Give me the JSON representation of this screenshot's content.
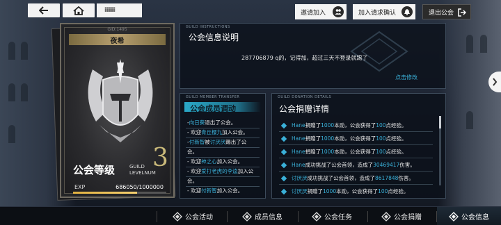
{
  "topbar": {
    "page_id": "iiiiiiiiii",
    "invite_label": "邀请加入",
    "requests_label": "加入请求确认",
    "exit_label": "退出公会",
    "back_icon": "back-arrow-icon",
    "home_icon": "home-icon"
  },
  "guild": {
    "gid": "GID:1495",
    "name": "夜希",
    "level_label": "公会等级",
    "level_sub": "GUILD LEVELNUM",
    "level": "3",
    "exp_label": "EXP",
    "exp_value": "686050/1000000",
    "exp_progress": 0.686
  },
  "info_panel": {
    "tag": "GUILD INSTRUCTIONS",
    "title": "公会信息说明",
    "text": "287706879   q的，记得加，超过三天不登录就踢了",
    "edit_label": "点击修改"
  },
  "transfer_panel": {
    "tag": "GUILD MEMBER TRANSFER",
    "title": "公会成员调动",
    "items": [
      {
        "prefix": "-",
        "name1": "向日葵",
        "text": "退出了公会。",
        "name2": "",
        "text2": ""
      },
      {
        "prefix": "- 欢迎",
        "name1": "青丘樱九",
        "text": "加入公会。",
        "name2": "",
        "text2": ""
      },
      {
        "prefix": "-",
        "name1": "付新智",
        "text": "被",
        "name2": "讨厌厌",
        "text2": "踢出了公"
      },
      {
        "prefix": "",
        "name1": "",
        "text": "会。",
        "name2": "",
        "text2": ""
      },
      {
        "prefix": "- 欢迎",
        "name1": "神之心",
        "text": "加入公会。",
        "name2": "",
        "text2": ""
      },
      {
        "prefix": "- 欢迎",
        "name1": "爱打老虎的李逵",
        "text": "加入公",
        "name2": "",
        "text2": ""
      },
      {
        "prefix": "",
        "name1": "",
        "text": "会。",
        "name2": "",
        "text2": ""
      },
      {
        "prefix": "- 欢迎",
        "name1": "付新智",
        "text": "加入公会。",
        "name2": "",
        "text2": ""
      }
    ]
  },
  "donation_panel": {
    "tag": "GUILD DONATION DETAILS",
    "title": "公会捐赠详情",
    "items": [
      {
        "name": "Hane",
        "a": "捐赠了",
        "v1": "1000",
        "b": "本勋，公会获得了",
        "v2": "100",
        "c": "点经验。"
      },
      {
        "name": "Hane",
        "a": "捐赠了",
        "v1": "1000",
        "b": "本勋，公会获得了",
        "v2": "100",
        "c": "点经验。"
      },
      {
        "name": "Hane",
        "a": "捐赠了",
        "v1": "1000",
        "b": "本勋，公会获得了",
        "v2": "100",
        "c": "点经验。"
      },
      {
        "name": "Hane",
        "a": "成功挑战了公会首领，造成了",
        "v1": "30469417",
        "b": "伤害。",
        "v2": "",
        "c": ""
      },
      {
        "name": "讨厌厌",
        "a": "成功挑战了公会首领，造成了",
        "v1": "8617848",
        "b": "伤害。",
        "v2": "",
        "c": ""
      },
      {
        "name": "讨厌厌",
        "a": "捐赠了",
        "v1": "1000",
        "b": "本勋，公会获得了",
        "v2": "100",
        "c": "点经验。"
      }
    ]
  },
  "bottomnav": {
    "items": [
      {
        "label": "公会活动"
      },
      {
        "label": "成员信息"
      },
      {
        "label": "公会任务"
      },
      {
        "label": "公会捐赠"
      },
      {
        "label": "公会信息"
      }
    ]
  },
  "colors": {
    "accent": "#3ab0d8",
    "gold": "#c9b97a"
  }
}
